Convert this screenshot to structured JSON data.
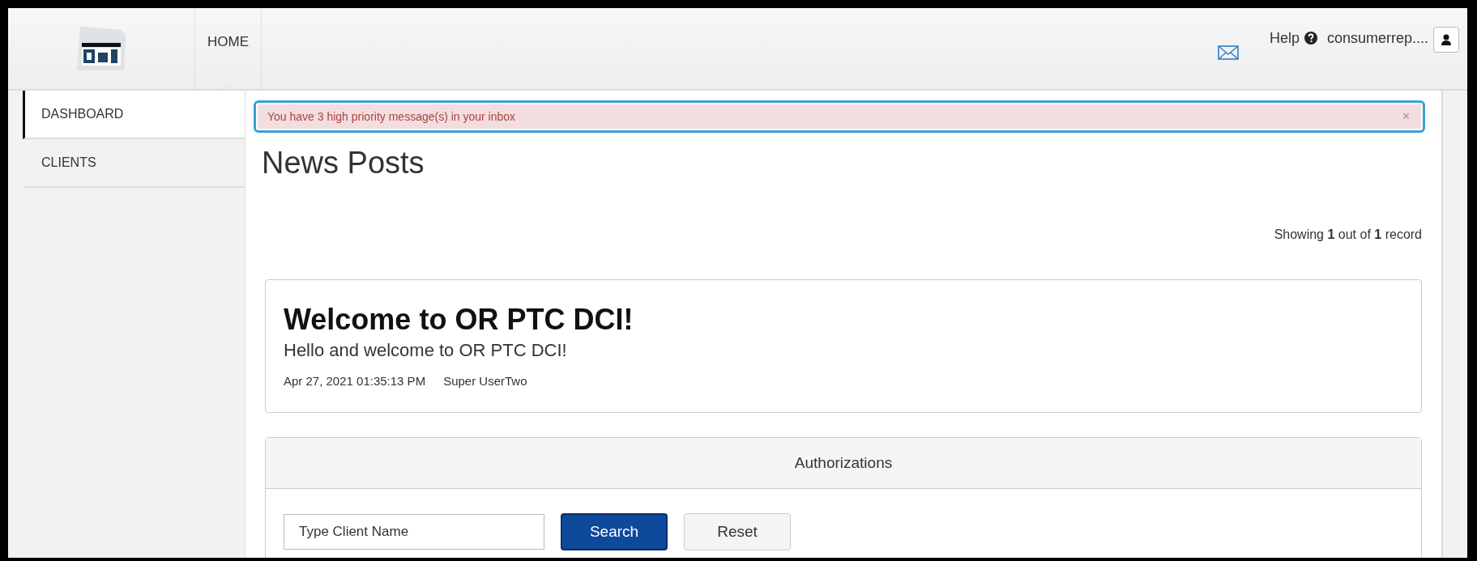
{
  "header": {
    "nav_tabs": [
      {
        "label": "HOME",
        "selected": true
      }
    ],
    "help": "Help",
    "username": "consumerrep...."
  },
  "sidebar": {
    "items": [
      {
        "label": "DASHBOARD",
        "selected": true
      },
      {
        "label": "CLIENTS",
        "selected": false
      }
    ]
  },
  "alert": {
    "text": "You have 3 high priority message(s) in your inbox",
    "close": "×",
    "highlighted": true
  },
  "page_title": "News Posts",
  "record_count": "Showing **1** out of **1** record",
  "posts": [
    {
      "title": "Welcome to OR PTC DCI!",
      "body": "Hello and welcome to OR PTC DCI!",
      "date": "Apr 27, 2021 01:35:13 PM",
      "author": "Super UserTwo"
    }
  ],
  "authorizations": {
    "title": "Authorizations",
    "search": {
      "placeholder": "Type Client Name"
    },
    "buttons": [
      {
        "label": "Search",
        "kind": "primary"
      },
      {
        "label": "Reset",
        "kind": "default"
      }
    ]
  }
}
